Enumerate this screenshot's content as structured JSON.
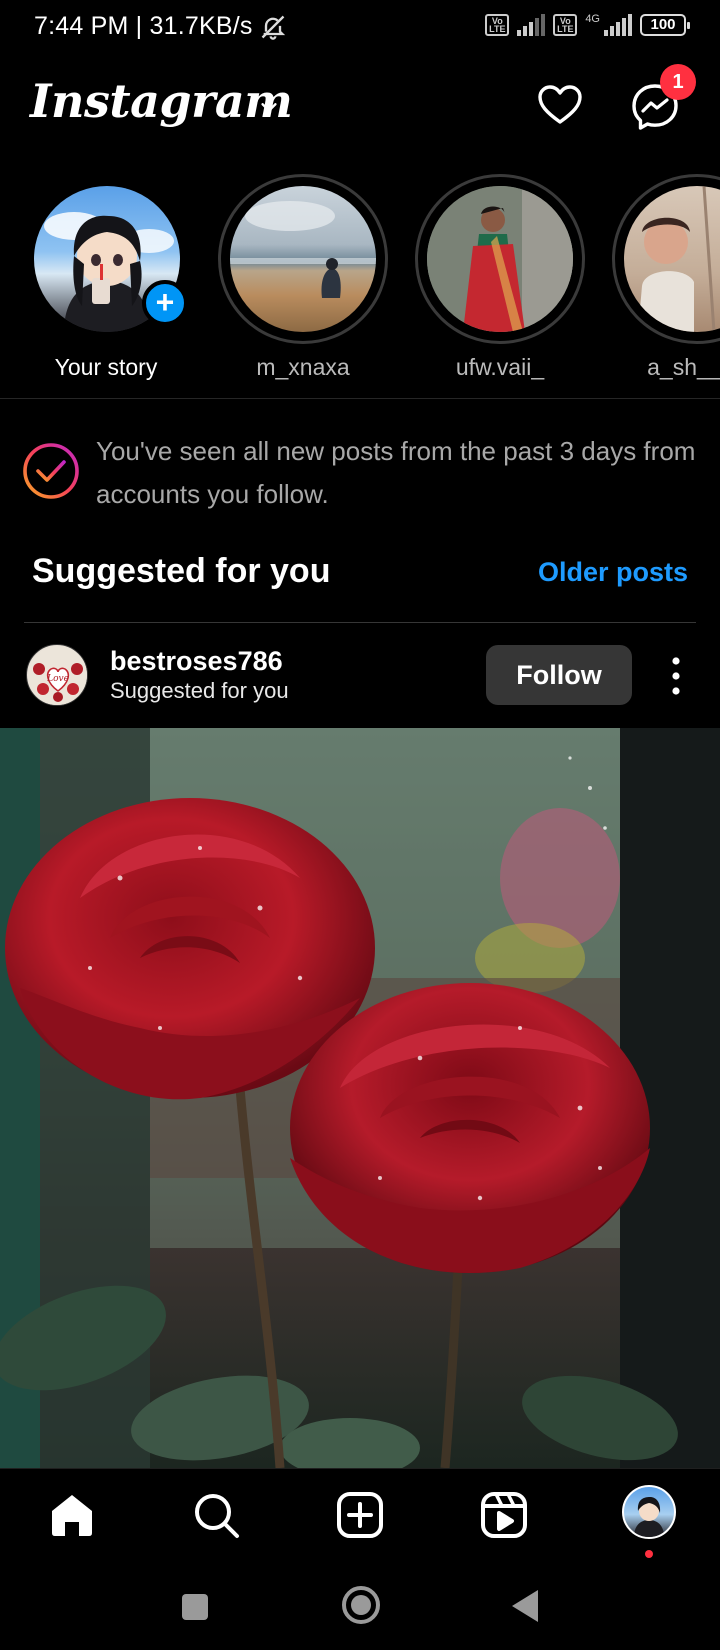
{
  "status_bar": {
    "time_speed": "7:44 PM | 31.7KB/s",
    "volte1": "Vo LTE",
    "volte2": "Vo LTE",
    "network": "4G",
    "battery": "100"
  },
  "header": {
    "logo": "Instagram",
    "messages_badge": "1"
  },
  "stories": [
    {
      "name": "Your story"
    },
    {
      "name": "m_xnaxa"
    },
    {
      "name": "ufw.vaii_"
    },
    {
      "name": "a_sh__x_"
    }
  ],
  "feed": {
    "caught_up_text": "You've seen all new posts from the past 3 days from accounts you follow.",
    "suggested_title": "Suggested for you",
    "older_posts_label": "Older posts"
  },
  "post": {
    "username": "bestroses786",
    "subtitle": "Suggested for you",
    "follow_label": "Follow",
    "avatar_text": "Love"
  },
  "colors": {
    "accent_blue": "#0095f6",
    "link_blue": "#1e9bff",
    "badge_red": "#ff3040",
    "background": "#000000"
  },
  "icons": {
    "bottom_nav": [
      "home-icon",
      "search-icon",
      "create-icon",
      "reels-icon",
      "profile-avatar"
    ],
    "system_nav": [
      "recents-icon",
      "home-circle-icon",
      "back-icon"
    ]
  }
}
